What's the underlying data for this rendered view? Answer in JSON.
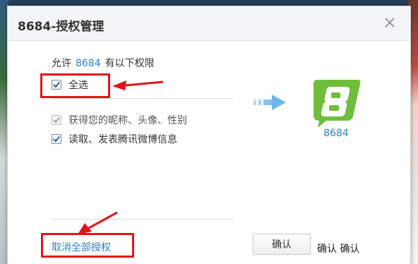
{
  "window": {
    "title": "8684-授权管理"
  },
  "intro": {
    "prefix": "允许",
    "app_name": "8684",
    "suffix": "有以下权限"
  },
  "select_all": {
    "label": "全选",
    "checked": true
  },
  "permissions": [
    {
      "label": "获得您的昵称、头像、性别",
      "checked": true,
      "disabled": true
    },
    {
      "label": "读取、发表腾讯微博信息",
      "checked": true,
      "disabled": false
    }
  ],
  "app": {
    "logo_icon": "8684-logo-icon",
    "name": "8684",
    "logo_color": "#6fbe3b"
  },
  "footer": {
    "cancel_all_label": "取消全部授权",
    "confirm_label": "确认",
    "overlay_text": "确认 确认"
  },
  "annotations": {
    "highlight_color": "#e0151b"
  }
}
